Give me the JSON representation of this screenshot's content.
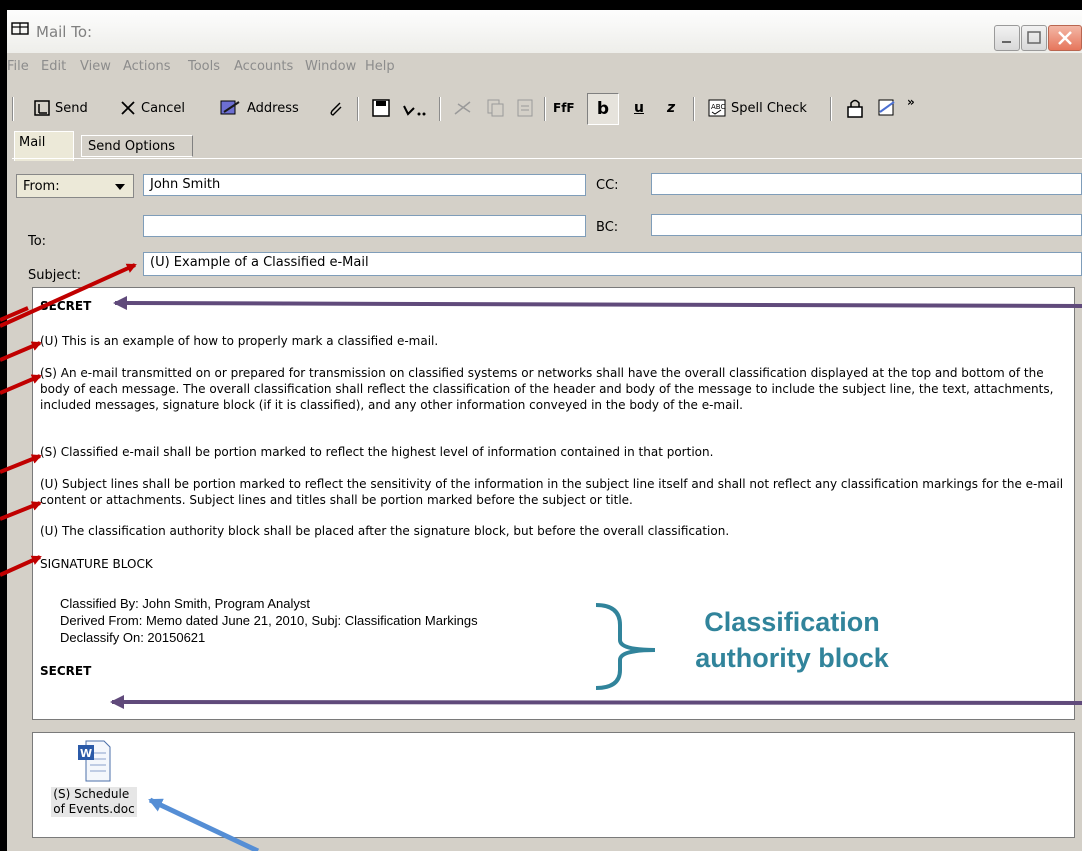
{
  "window": {
    "title": "Mail To:"
  },
  "menu": [
    "File",
    "Edit",
    "View",
    "Actions",
    "Tools",
    "Accounts",
    "Window",
    "Help"
  ],
  "toolbar": {
    "send": "Send",
    "cancel": "Cancel",
    "address": "Address",
    "spell_check": "Spell Check",
    "bold": "b",
    "underline": "u",
    "italic": "z",
    "font": "FfF",
    "overflow": "»"
  },
  "tabs": {
    "mail": "Mail",
    "send_options": "Send Options"
  },
  "form": {
    "from_label": "From:",
    "from_value": "John Smith",
    "to_label": "To:",
    "to_value": "",
    "subject_label": "Subject:",
    "subject_value": "(U) Example of a Classified e-Mail",
    "cc_label": "CC:",
    "cc_value": "",
    "bc_label": "BC:",
    "bc_value": ""
  },
  "body": {
    "banner_top": "SECRET",
    "p1": "(U) This is an example of how to properly mark a classified e-mail.",
    "p2": "(S) An e-mail transmitted on or prepared for transmission on classified systems or networks shall have the overall classification displayed at the top and bottom of the body of each message.  The overall classification shall reflect the classification of the header and body of the message to include the subject line, the text, attachments, included messages, signature block (if it is classified), and any other information conveyed in the body of the e-mail.",
    "p3": "(S) Classified e-mail shall be portion marked to reflect the highest level of information contained in that portion.",
    "p4": "(U) Subject lines shall be portion marked to reflect the sensitivity of the information in the subject line itself and shall not reflect any classification markings for the e-mail content or attachments.  Subject lines and titles shall be portion marked before the subject or title.",
    "p5": "(U) The classification authority block shall be placed after the signature block, but before the overall classification.",
    "signature": "SIGNATURE BLOCK",
    "classified_by": "Classified By:  John Smith, Program Analyst",
    "derived_from": "Derived From:   Memo dated June 21, 2010, Subj:  Classification Markings",
    "declassify_on": "Declassify On:  20150621",
    "banner_bottom": "SECRET"
  },
  "attachment": {
    "name_line1": "(S) Schedule",
    "name_line2": "of Events.doc"
  },
  "annotation": {
    "line1": "Classification",
    "line2": "authority block"
  },
  "colors": {
    "red_arrow": "#c00000",
    "purple_arrow": "#604a7b",
    "blue_arrow": "#558ed5",
    "annot_text": "#31849b"
  }
}
